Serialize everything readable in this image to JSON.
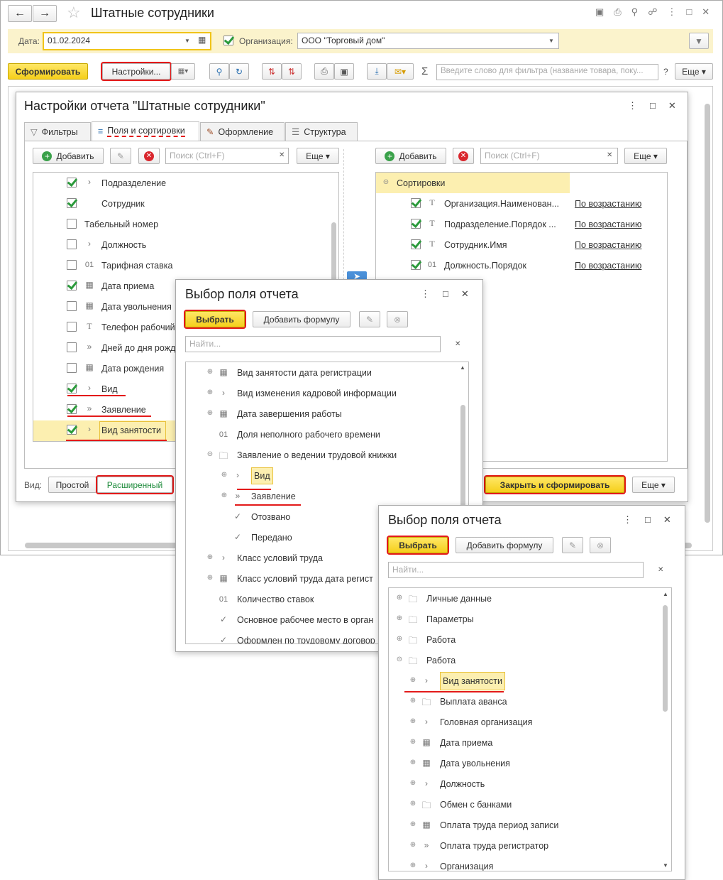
{
  "main": {
    "title": "Штатные сотрудники",
    "date_label": "Дата:",
    "date_value": "01.02.2024",
    "org_label": "Организация:",
    "org_value": "ООО \"Торговый дом\"",
    "generate": "Сформировать",
    "settings": "Настройки...",
    "filter_placeholder": "Введите слово для фильтра (название товара, поку...",
    "help": "?",
    "more": "Еще"
  },
  "settings": {
    "title": "Настройки отчета \"Штатные сотрудники\"",
    "tabs": [
      "Фильтры",
      "Поля и сортировки",
      "Оформление",
      "Структура"
    ],
    "add": "Добавить",
    "search_placeholder": "Поиск (Ctrl+F)",
    "more": "Еще",
    "fields": [
      {
        "label": "Подразделение",
        "checked": true,
        "icon": ">"
      },
      {
        "label": "Сотрудник",
        "checked": true,
        "icon": ""
      },
      {
        "label": "Табельный номер",
        "checked": false,
        "icon": ""
      },
      {
        "label": "Должность",
        "checked": false,
        "icon": ">"
      },
      {
        "label": "Тарифная ставка",
        "checked": false,
        "icon": "01"
      },
      {
        "label": "Дата приема",
        "checked": true,
        "icon": "cal"
      },
      {
        "label": "Дата увольнения",
        "checked": false,
        "icon": "cal"
      },
      {
        "label": "Телефон рабочий",
        "checked": false,
        "icon": "T"
      },
      {
        "label": "Дней до дня рожд",
        "checked": false,
        "icon": ">>"
      },
      {
        "label": "Дата рождения",
        "checked": false,
        "icon": "cal"
      },
      {
        "label": "Вид",
        "checked": true,
        "icon": ">"
      },
      {
        "label": "Заявление",
        "checked": true,
        "icon": ">>"
      },
      {
        "label": "Вид занятости",
        "checked": true,
        "icon": ">"
      }
    ],
    "sort_root": "Сортировки",
    "sorts": [
      {
        "label": "Организация.Наименован...",
        "icon": "T",
        "order": "По возрастанию"
      },
      {
        "label": "Подразделение.Порядок ...",
        "icon": "T",
        "order": "По возрастанию"
      },
      {
        "label": "Сотрудник.Имя",
        "icon": "T",
        "order": "По возрастанию"
      },
      {
        "label": "Должность.Порядок",
        "icon": "01",
        "order": "По возрастанию"
      }
    ],
    "view_label": "Вид:",
    "view_simple": "Простой",
    "view_extended": "Расширенный",
    "close_generate": "Закрыть и сформировать"
  },
  "dialog1": {
    "title": "Выбор поля отчета",
    "select": "Выбрать",
    "add_formula": "Добавить формулу",
    "search_placeholder": "Найти...",
    "items": [
      {
        "label": "Вид занятости дата регистрации",
        "icon": "cal",
        "plus": true,
        "indent": 0
      },
      {
        "label": "Вид изменения кадровой информации",
        "icon": ">",
        "plus": true,
        "indent": 0
      },
      {
        "label": "Дата завершения работы",
        "icon": "cal",
        "plus": true,
        "indent": 0
      },
      {
        "label": "Доля неполного рабочего времени",
        "icon": "01",
        "plus": false,
        "indent": 0
      },
      {
        "label": "Заявление о ведении трудовой книжки",
        "icon": "folder",
        "plus": true,
        "minus": true,
        "indent": 0
      },
      {
        "label": "Вид",
        "icon": ">",
        "plus": true,
        "indent": 1
      },
      {
        "label": "Заявление",
        "icon": ">>",
        "plus": true,
        "indent": 1
      },
      {
        "label": "Отозвано",
        "icon": "✓",
        "plus": false,
        "indent": 1
      },
      {
        "label": "Передано",
        "icon": "✓",
        "plus": false,
        "indent": 1
      },
      {
        "label": "Класс условий труда",
        "icon": ">",
        "plus": true,
        "indent": 0
      },
      {
        "label": "Класс условий труда дата регист",
        "icon": "cal",
        "plus": true,
        "indent": 0
      },
      {
        "label": "Количество ставок",
        "icon": "01",
        "plus": false,
        "indent": 0
      },
      {
        "label": "Основное рабочее место в орган",
        "icon": "✓",
        "plus": false,
        "indent": 0
      },
      {
        "label": "Оформлен по трудовому договор",
        "icon": "✓",
        "plus": false,
        "indent": 0
      }
    ]
  },
  "dialog2": {
    "title": "Выбор поля отчета",
    "select": "Выбрать",
    "add_formula": "Добавить формулу",
    "search_placeholder": "Найти...",
    "items": [
      {
        "label": "Личные данные",
        "icon": "folder",
        "indent": 0
      },
      {
        "label": "Параметры",
        "icon": "folder",
        "indent": 0
      },
      {
        "label": "Работа",
        "icon": "folder",
        "indent": 0
      },
      {
        "label": "Работа",
        "icon": "folder",
        "indent": 0,
        "minus": true
      },
      {
        "label": "Вид занятости",
        "icon": ">",
        "indent": 1
      },
      {
        "label": "Выплата аванса",
        "icon": "folder",
        "indent": 1
      },
      {
        "label": "Головная организация",
        "icon": ">",
        "indent": 1
      },
      {
        "label": "Дата приема",
        "icon": "cal",
        "indent": 1
      },
      {
        "label": "Дата увольнения",
        "icon": "cal",
        "indent": 1
      },
      {
        "label": "Должность",
        "icon": ">",
        "indent": 1
      },
      {
        "label": "Обмен с банками",
        "icon": "folder",
        "indent": 1
      },
      {
        "label": "Оплата труда период записи",
        "icon": "cal",
        "indent": 1
      },
      {
        "label": "Оплата труда регистратор",
        "icon": ">>",
        "indent": 1
      },
      {
        "label": "Организация",
        "icon": ">",
        "indent": 1
      }
    ]
  }
}
